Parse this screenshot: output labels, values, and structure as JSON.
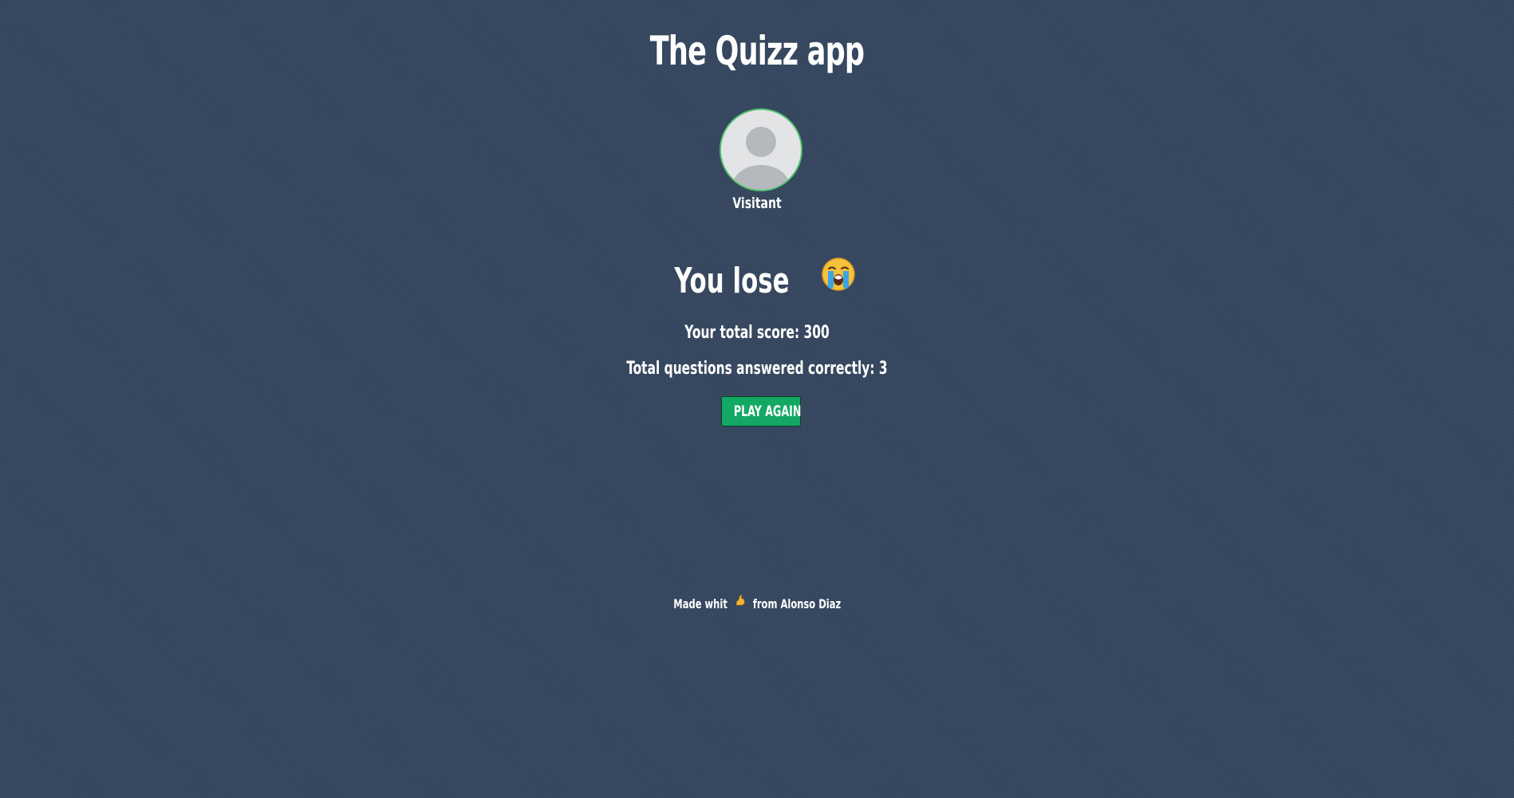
{
  "app": {
    "title": "The Quizz app"
  },
  "user": {
    "name": "Visitant",
    "avatar_icon": "default-user-icon"
  },
  "result": {
    "heading": "You lose",
    "emoji": "crying-face-icon",
    "score_text": "Your total score: 300",
    "correct_text": "Total questions answered correctly: 3"
  },
  "actions": {
    "play_again_label": "PLAY AGAIN"
  },
  "footer": {
    "prefix": "Made whit",
    "emoji": "flexed-biceps-icon",
    "suffix": "from Alonso Diaz"
  },
  "colors": {
    "background": "#35475f",
    "button": "#13a863",
    "avatar_ring": "#4fc36b",
    "text": "#ffffff"
  }
}
